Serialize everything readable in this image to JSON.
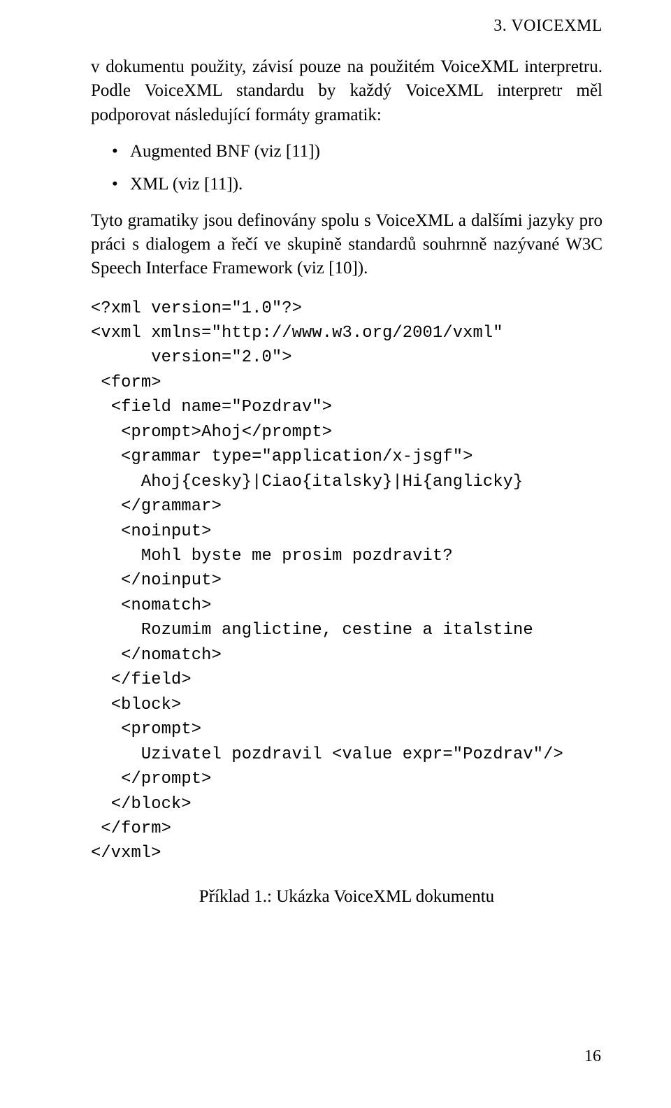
{
  "header": {
    "text": "3. VOICEXML",
    "num": "3."
  },
  "paragraph1": "v dokumentu použity, závisí pouze na použitém VoiceXML interpretru. Podle VoiceXML standardu by každý VoiceXML interpretr měl podporovat následující formáty gramatik:",
  "bullets": [
    "Augmented BNF (viz [11])",
    "XML (viz [11])."
  ],
  "paragraph2": "Tyto gramatiky jsou definovány spolu s VoiceXML a dalšími jazyky pro práci s dialogem a řečí ve skupině standardů souhrnně nazývané W3C Speech Interface Framework (viz [10]).",
  "code": "<?xml version=\"1.0\"?>\n<vxml xmlns=\"http://www.w3.org/2001/vxml\"\n      version=\"2.0\">\n <form>\n  <field name=\"Pozdrav\">\n   <prompt>Ahoj</prompt>\n   <grammar type=\"application/x-jsgf\">\n     Ahoj{cesky}|Ciao{italsky}|Hi{anglicky}\n   </grammar>\n   <noinput>\n     Mohl byste me prosim pozdravit?\n   </noinput>\n   <nomatch>\n     Rozumim anglictine, cestine a italstine\n   </nomatch>\n  </field>\n  <block>\n   <prompt>\n     Uzivatel pozdravil <value expr=\"Pozdrav\"/>\n   </prompt>\n  </block>\n </form>\n</vxml>",
  "caption": "Příklad 1.: Ukázka VoiceXML dokumentu",
  "pagenum": "16"
}
